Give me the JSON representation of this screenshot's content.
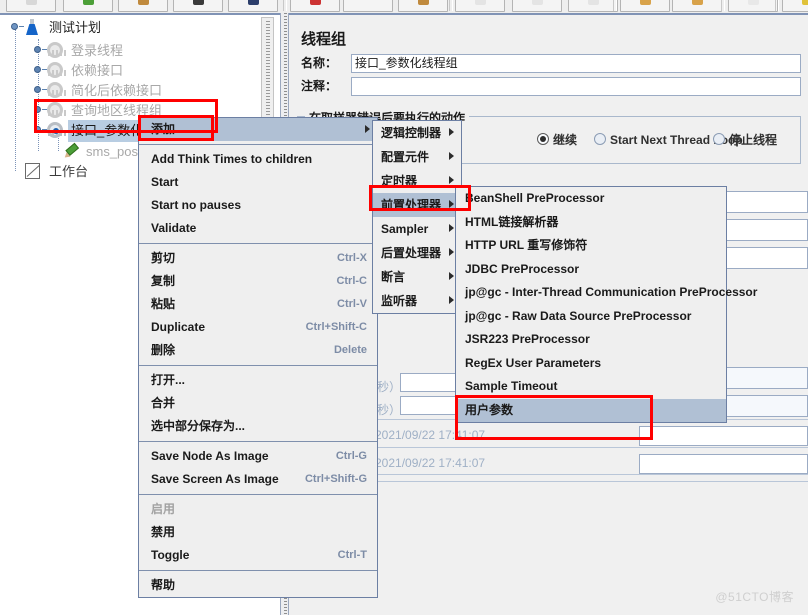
{
  "app": {
    "watermark": "@51CTO博客"
  },
  "toolbar": {
    "buttons": [
      {
        "name": "new",
        "glyph_color": "#d8d8d8"
      },
      {
        "name": "templates",
        "glyph_color": "#4c9f38"
      },
      {
        "name": "open",
        "glyph_color": "#c08a3e"
      },
      {
        "name": "close",
        "glyph_color": "#3a3a3a"
      },
      {
        "name": "save",
        "glyph_color": "#2c3e6b"
      },
      {
        "name": "cut",
        "glyph_color": "#cc3333"
      },
      {
        "name": "copy",
        "glyph_color": "#f4f4f4"
      },
      {
        "name": "paste",
        "glyph_color": "#c08a3e"
      },
      {
        "name": "expand",
        "glyph_color": "#e4e4e4"
      },
      {
        "name": "collapse",
        "glyph_color": "#e4e4e4"
      },
      {
        "name": "toggle",
        "glyph_color": "#e4e4e4"
      },
      {
        "name": "start",
        "glyph_color": "#d8a24a"
      },
      {
        "name": "start-no-pauses",
        "glyph_color": "#d8a24a"
      },
      {
        "name": "stop",
        "glyph_color": "#e8e8e8"
      },
      {
        "name": "shutdown",
        "glyph_color": "#e0c23a"
      }
    ]
  },
  "tree": {
    "nodes": [
      {
        "label": "测试计划",
        "icon": "test-plan-flask-icon",
        "state": "root"
      },
      {
        "label": "登录线程",
        "icon": "thread-group-gear-icon",
        "state": "disabled"
      },
      {
        "label": "依赖接口",
        "icon": "thread-group-gear-icon",
        "state": "disabled"
      },
      {
        "label": "简化后依赖接口",
        "icon": "thread-group-gear-icon",
        "state": "disabled"
      },
      {
        "label": "查询地区线程组",
        "icon": "thread-group-gear-icon",
        "state": "disabled"
      },
      {
        "label": "接口_参数化线程组",
        "icon": "thread-group-gear-icon",
        "state": "selected"
      },
      {
        "label": "sms_post",
        "icon": "http-sampler-pen-icon",
        "state": "disabled"
      },
      {
        "label": "工作台",
        "icon": "workbench-icon",
        "state": "normal"
      }
    ]
  },
  "right_panel": {
    "title": "线程组",
    "name_label": "名称：",
    "name_value": "接口_参数化线程组",
    "comment_label": "注释：",
    "comment_value": "",
    "error_action_group_title": "在取样器错误后要执行的动作",
    "error_actions": [
      {
        "label": "继续",
        "selected": true
      },
      {
        "label": "Start Next Thread Loop",
        "selected": false
      },
      {
        "label": "停止线程",
        "selected": false
      }
    ],
    "delay_unit_label_1": "秒）",
    "delay_unit_label_2": "秒）",
    "start_time_value": "2021/09/22 17:41:07",
    "end_time_value": "2021/09/22 17:41:07"
  },
  "context_menu": {
    "items": [
      {
        "label": "添加",
        "accel": "",
        "submenu": true,
        "highlighted": true
      },
      {
        "separator": true
      },
      {
        "label": "Add Think Times to children",
        "accel": ""
      },
      {
        "label": "Start",
        "accel": ""
      },
      {
        "label": "Start no pauses",
        "accel": ""
      },
      {
        "label": "Validate",
        "accel": ""
      },
      {
        "separator": true
      },
      {
        "label": "剪切",
        "accel": "Ctrl-X"
      },
      {
        "label": "复制",
        "accel": "Ctrl-C"
      },
      {
        "label": "粘贴",
        "accel": "Ctrl-V"
      },
      {
        "label": "Duplicate",
        "accel": "Ctrl+Shift-C"
      },
      {
        "label": "删除",
        "accel": "Delete"
      },
      {
        "separator": true
      },
      {
        "label": "打开...",
        "accel": ""
      },
      {
        "label": "合并",
        "accel": ""
      },
      {
        "label": "选中部分保存为...",
        "accel": ""
      },
      {
        "separator": true
      },
      {
        "label": "Save Node As Image",
        "accel": "Ctrl-G"
      },
      {
        "label": "Save Screen As Image",
        "accel": "Ctrl+Shift-G"
      },
      {
        "separator": true
      },
      {
        "label": "启用",
        "accel": "",
        "disabled": true
      },
      {
        "label": "禁用",
        "accel": ""
      },
      {
        "label": "Toggle",
        "accel": "Ctrl-T"
      },
      {
        "separator": true
      },
      {
        "label": "帮助",
        "accel": ""
      }
    ]
  },
  "add_submenu": {
    "items": [
      {
        "label": "逻辑控制器",
        "submenu": true
      },
      {
        "label": "配置元件",
        "submenu": true
      },
      {
        "label": "定时器",
        "submenu": true
      },
      {
        "label": "前置处理器",
        "submenu": true,
        "highlighted": true
      },
      {
        "label": "Sampler",
        "submenu": true
      },
      {
        "label": "后置处理器",
        "submenu": true
      },
      {
        "label": "断言",
        "submenu": true
      },
      {
        "label": "监听器",
        "submenu": true
      }
    ]
  },
  "preprocessor_submenu": {
    "items": [
      {
        "label": "BeanShell PreProcessor"
      },
      {
        "label": "HTML链接解析器"
      },
      {
        "label": "HTTP URL 重写修饰符"
      },
      {
        "label": "JDBC PreProcessor"
      },
      {
        "label": "jp@gc - Inter-Thread Communication PreProcessor"
      },
      {
        "label": "jp@gc - Raw Data Source PreProcessor"
      },
      {
        "label": "JSR223 PreProcessor"
      },
      {
        "label": "RegEx User Parameters"
      },
      {
        "label": "Sample Timeout"
      },
      {
        "label": "用户参数",
        "highlighted": true
      }
    ]
  },
  "annotations": {
    "highlight_color": "#ff0000",
    "boxes": [
      {
        "name": "selected-thread-group-box"
      },
      {
        "name": "add-menu-item-box"
      },
      {
        "name": "preprocessor-submenu-box"
      },
      {
        "name": "user-parameters-item-box"
      }
    ]
  }
}
